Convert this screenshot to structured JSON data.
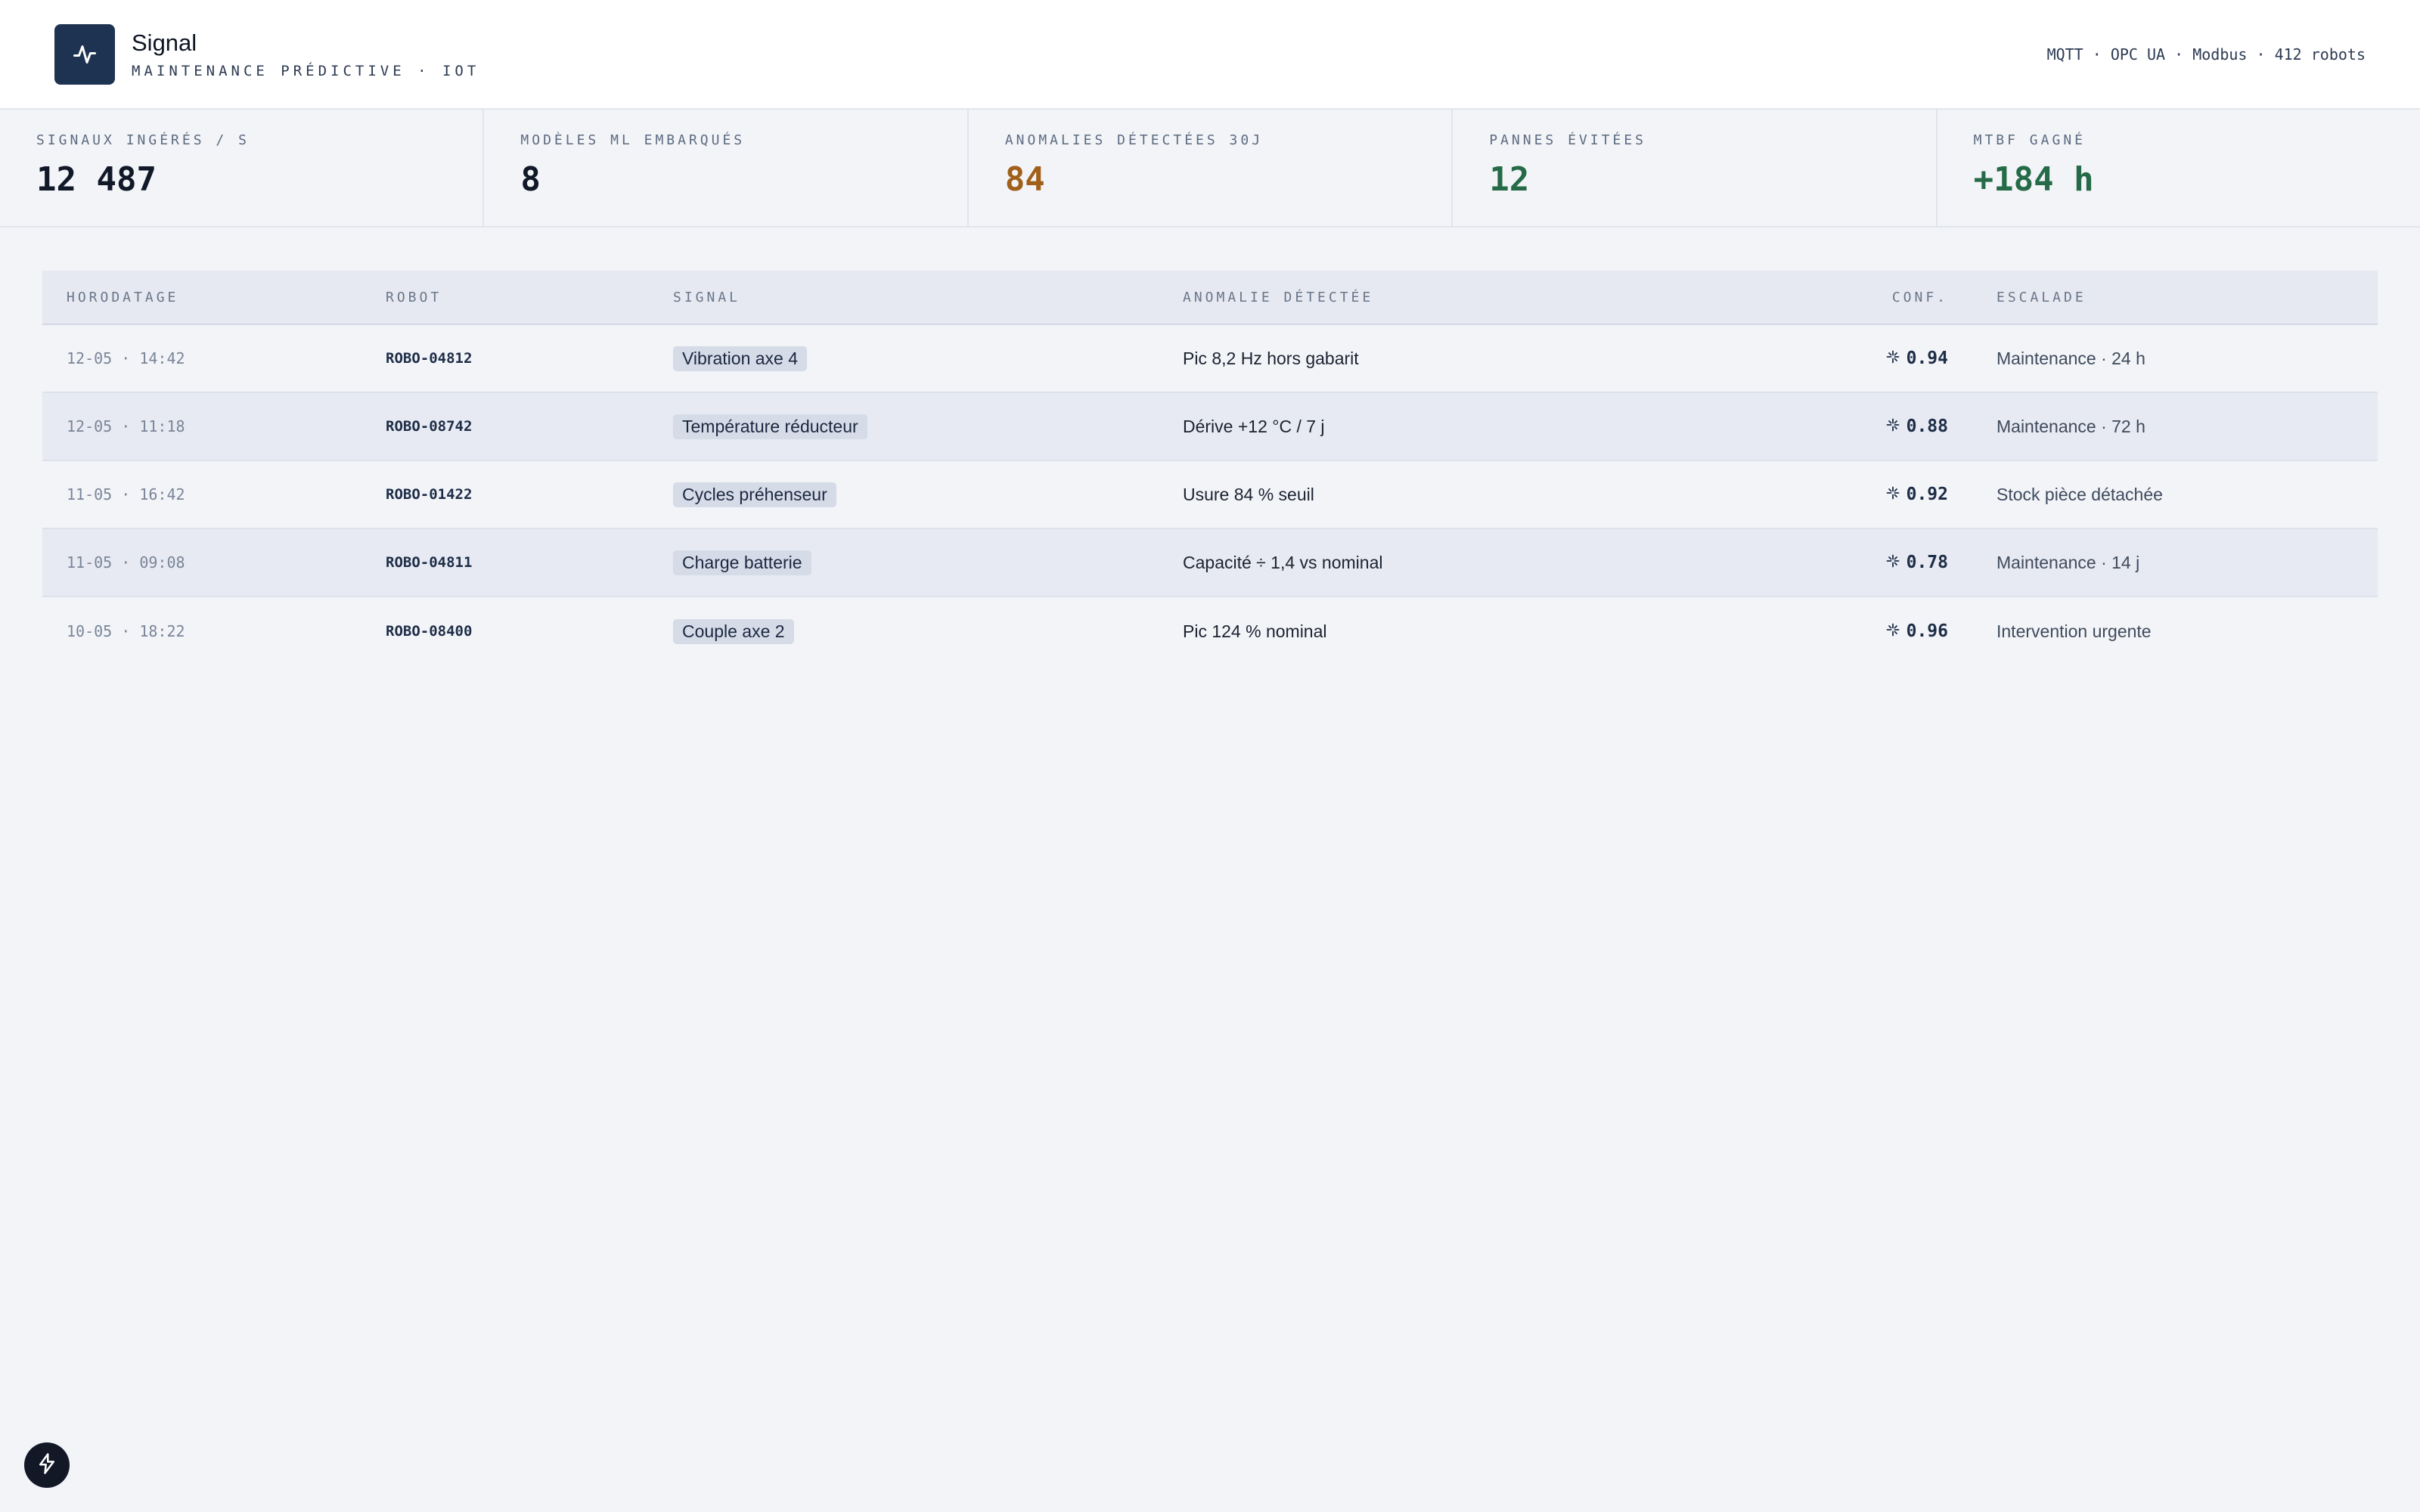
{
  "brand": {
    "name": "Signal",
    "subtitle": "MAINTENANCE PRÉDICTIVE · IOT"
  },
  "header_meta": "MQTT · OPC UA · Modbus · 412 robots",
  "colors": {
    "brand_dark": "#1e3252",
    "warning": "#a0601a",
    "success": "#256b47"
  },
  "kpis": [
    {
      "label": "SIGNAUX INGÉRÉS / S",
      "value": "12 487",
      "color": "#111827"
    },
    {
      "label": "MODÈLES ML EMBARQUÉS",
      "value": "8",
      "color": "#111827"
    },
    {
      "label": "ANOMALIES DÉTECTÉES 30J",
      "value": "84",
      "color": "#a0601a"
    },
    {
      "label": "PANNES ÉVITÉES",
      "value": "12",
      "color": "#256b47"
    },
    {
      "label": "MTBF GAGNÉ",
      "value": "+184 h",
      "color": "#256b47"
    }
  ],
  "table": {
    "headers": [
      "HORODATAGE",
      "ROBOT",
      "SIGNAL",
      "ANOMALIE DÉTECTÉE",
      "CONF.",
      "ESCALADE"
    ],
    "rows": [
      {
        "time": "12-05 · 14:42",
        "robot": "ROBO-04812",
        "signal": "Vibration axe 4",
        "anomaly": "Pic 8,2 Hz hors gabarit",
        "conf": "0.94",
        "escalade": "Maintenance · 24 h"
      },
      {
        "time": "12-05 · 11:18",
        "robot": "ROBO-08742",
        "signal": "Température réducteur",
        "anomaly": "Dérive +12 °C / 7 j",
        "conf": "0.88",
        "escalade": "Maintenance · 72 h"
      },
      {
        "time": "11-05 · 16:42",
        "robot": "ROBO-01422",
        "signal": "Cycles préhenseur",
        "anomaly": "Usure 84 % seuil",
        "conf": "0.92",
        "escalade": "Stock pièce détachée"
      },
      {
        "time": "11-05 · 09:08",
        "robot": "ROBO-04811",
        "signal": "Charge batterie",
        "anomaly": "Capacité ÷ 1,4 vs nominal",
        "conf": "0.78",
        "escalade": "Maintenance · 14 j"
      },
      {
        "time": "10-05 · 18:22",
        "robot": "ROBO-08400",
        "signal": "Couple axe 2",
        "anomaly": "Pic 124 % nominal",
        "conf": "0.96",
        "escalade": "Intervention urgente"
      }
    ]
  },
  "icons": {
    "logo": "pulse-icon",
    "confidence": "sparkle-icon",
    "fab": "bolt-icon"
  }
}
